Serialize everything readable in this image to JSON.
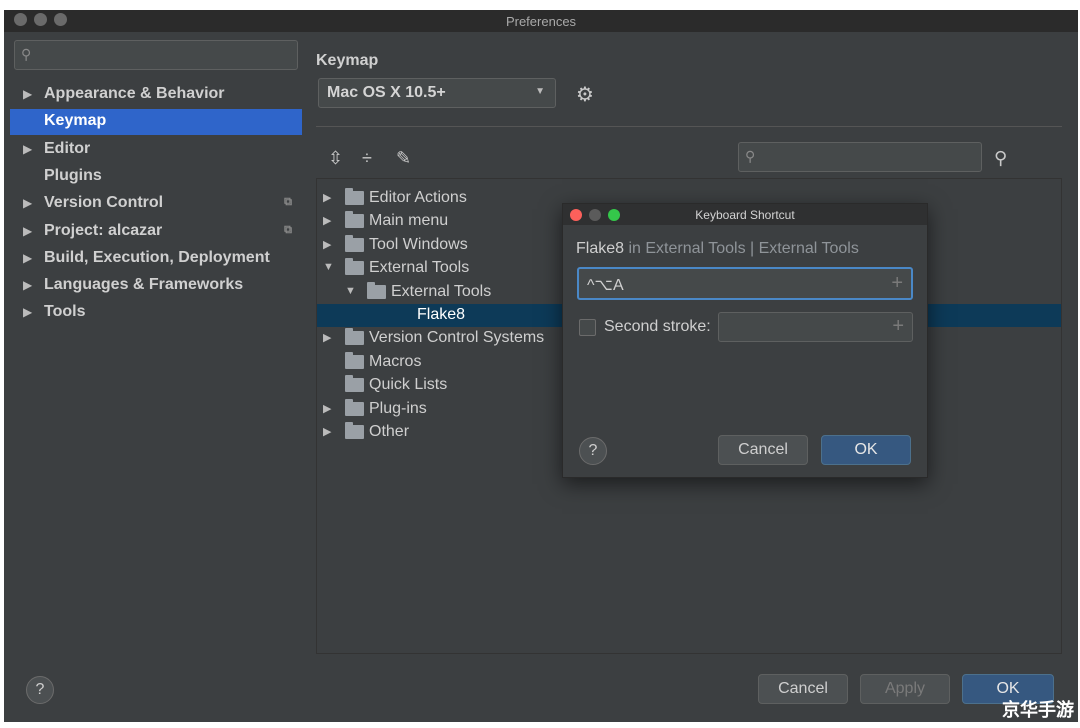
{
  "window": {
    "title": "Preferences"
  },
  "sidebar": {
    "search_placeholder": "",
    "items": [
      {
        "label": "Appearance & Behavior",
        "expandable": true
      },
      {
        "label": "Keymap",
        "expandable": false,
        "selected": true
      },
      {
        "label": "Editor",
        "expandable": true
      },
      {
        "label": "Plugins",
        "expandable": false
      },
      {
        "label": "Version Control",
        "expandable": true,
        "project_scoped": true
      },
      {
        "label": "Project: alcazar",
        "expandable": true,
        "project_scoped": true
      },
      {
        "label": "Build, Execution, Deployment",
        "expandable": true
      },
      {
        "label": "Languages & Frameworks",
        "expandable": true
      },
      {
        "label": "Tools",
        "expandable": true
      }
    ]
  },
  "main": {
    "heading": "Keymap",
    "keymap_select": "Mac OS X 10.5+",
    "filter_placeholder": "",
    "tree": [
      {
        "label": "Editor Actions",
        "level": 0,
        "arrow": "▶",
        "icon": "editor-actions-icon"
      },
      {
        "label": "Main menu",
        "level": 0,
        "arrow": "▶",
        "icon": "menu-icon"
      },
      {
        "label": "Tool Windows",
        "level": 0,
        "arrow": "▶",
        "icon": "folder-icon"
      },
      {
        "label": "External Tools",
        "level": 0,
        "arrow": "▼",
        "icon": "external-tools-icon"
      },
      {
        "label": "External Tools",
        "level": 1,
        "arrow": "▼",
        "icon": "folder-icon"
      },
      {
        "label": "Flake8",
        "level": 2,
        "arrow": "",
        "icon": "",
        "selected": true
      },
      {
        "label": "Version Control Systems",
        "level": 0,
        "arrow": "▶",
        "icon": "folder-icon"
      },
      {
        "label": "Macros",
        "level": 0,
        "arrow": "",
        "icon": "folder-icon"
      },
      {
        "label": "Quick Lists",
        "level": 0,
        "arrow": "",
        "icon": "folder-icon"
      },
      {
        "label": "Plug-ins",
        "level": 0,
        "arrow": "▶",
        "icon": "folder-icon"
      },
      {
        "label": "Other",
        "level": 0,
        "arrow": "▶",
        "icon": "other-icon"
      }
    ]
  },
  "dialog": {
    "title": "Keyboard Shortcut",
    "action_name": "Flake8",
    "action_context": " in External Tools | External Tools",
    "first_stroke": "^⌥A",
    "second_stroke_label": "Second stroke:",
    "second_stroke_value": "",
    "second_stroke_checked": false,
    "cancel": "Cancel",
    "ok": "OK"
  },
  "footer": {
    "cancel": "Cancel",
    "apply": "Apply",
    "ok": "OK"
  },
  "watermark": "京华手游",
  "colors": {
    "selection": "#2f65ca",
    "tree_selection": "#0d3a58",
    "primary_button": "#365880"
  }
}
